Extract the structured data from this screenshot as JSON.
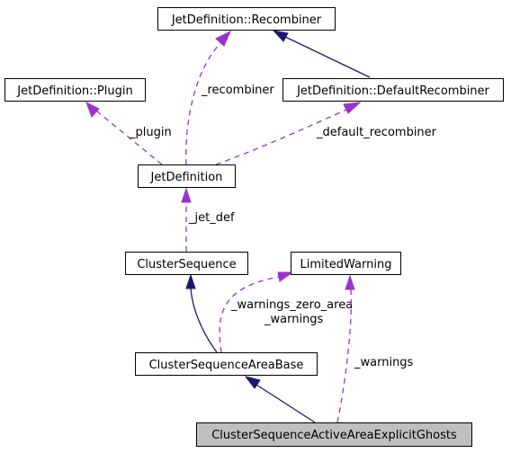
{
  "diagram": {
    "type": "collaboration-graph",
    "colors": {
      "inheritance_edge": "#191970",
      "usage_edge": "#9a32cd",
      "focus_node_fill": "#bfbfbf",
      "node_fill": "#ffffff",
      "node_border": "#000000"
    },
    "nodes": [
      {
        "id": "recombiner",
        "label": "JetDefinition::Recombiner"
      },
      {
        "id": "plugin",
        "label": "JetDefinition::Plugin"
      },
      {
        "id": "default_recombiner",
        "label": "JetDefinition::DefaultRecombiner"
      },
      {
        "id": "jet_definition",
        "label": "JetDefinition"
      },
      {
        "id": "cluster_sequence",
        "label": "ClusterSequence"
      },
      {
        "id": "limited_warning",
        "label": "LimitedWarning"
      },
      {
        "id": "cs_area_base",
        "label": "ClusterSequenceAreaBase"
      },
      {
        "id": "cs_active_area_explicit_ghosts",
        "label": "ClusterSequenceActiveAreaExplicitGhosts",
        "focus": true
      }
    ],
    "edges": [
      {
        "from": "default_recombiner",
        "to": "recombiner",
        "kind": "inheritance",
        "label": ""
      },
      {
        "from": "jet_definition",
        "to": "recombiner",
        "kind": "usage",
        "label": "_recombiner"
      },
      {
        "from": "jet_definition",
        "to": "plugin",
        "kind": "usage",
        "label": "_plugin"
      },
      {
        "from": "jet_definition",
        "to": "default_recombiner",
        "kind": "usage",
        "label": "_default_recombiner"
      },
      {
        "from": "cluster_sequence",
        "to": "jet_definition",
        "kind": "usage",
        "label": "_jet_def"
      },
      {
        "from": "cs_area_base",
        "to": "cluster_sequence",
        "kind": "inheritance",
        "label": ""
      },
      {
        "from": "cs_area_base",
        "to": "limited_warning",
        "kind": "usage",
        "label": "_warnings_zero_area\n_warnings"
      },
      {
        "from": "cs_active_area_explicit_ghosts",
        "to": "cs_area_base",
        "kind": "inheritance",
        "label": ""
      },
      {
        "from": "cs_active_area_explicit_ghosts",
        "to": "limited_warning",
        "kind": "usage",
        "label": "_warnings"
      }
    ],
    "labels": {
      "recombiner": "_recombiner",
      "plugin": "_plugin",
      "default_recombiner": "_default_recombiner",
      "jet_def": "_jet_def",
      "warnings_zero_area": "_warnings_zero_area",
      "warnings_a": "_warnings",
      "warnings_b": "_warnings"
    }
  }
}
